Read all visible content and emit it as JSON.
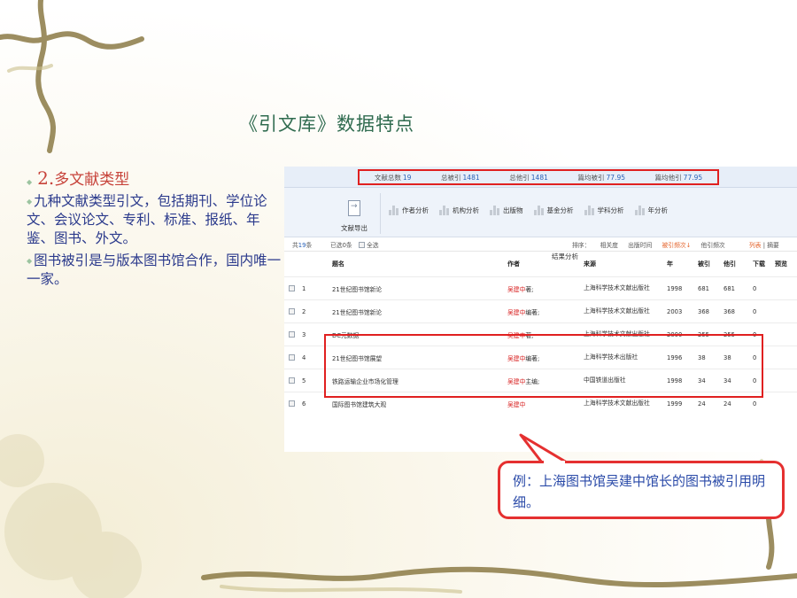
{
  "slide": {
    "title": "《引文库》数据特点",
    "section_number": "2.",
    "section_title": "多文献类型",
    "paragraphs": [
      "九种文献类型引文，包括期刊、学位论文、会议论文、专利、标准、报纸、年鉴、图书、外文。",
      "图书被引是与版本图书馆合作，国内唯一一家。"
    ],
    "callout": "例：上海图书馆吴建中馆长的图书被引用明细。"
  },
  "panel": {
    "stats": [
      {
        "label": "文献总数",
        "value": "19"
      },
      {
        "label": "总被引",
        "value": "1481"
      },
      {
        "label": "总他引",
        "value": "1481"
      },
      {
        "label": "篇均被引",
        "value": "77.95"
      },
      {
        "label": "篇均他引",
        "value": "77.95"
      }
    ],
    "export_label": "文献导出",
    "analysis_tools": [
      "作者分析",
      "机构分析",
      "出版物",
      "基金分析",
      "学科分析",
      "年分析"
    ],
    "result_label": "结果分析",
    "toolbar": {
      "count_prefix": "共",
      "count": "19",
      "count_suffix": "条",
      "selected": "已选0条",
      "select_all": "全选",
      "sort_label": "排序：",
      "sort_options": [
        "相关度",
        "出版时间",
        "被引频次↓",
        "他引频次"
      ],
      "active_sort": "被引频次↓",
      "view_list": "列表",
      "view_sep": "|",
      "view_abstract": "摘要"
    },
    "table": {
      "headers": {
        "title": "题名",
        "author": "作者",
        "source": "来源",
        "year": "年",
        "cited": "被引",
        "other": "他引",
        "download": "下载",
        "preview": "预览"
      },
      "rows": [
        {
          "no": "1",
          "title": "21世纪图书馆新论",
          "author_name": "吴建中",
          "author_role": "著;",
          "source": "上海科学技术文献出版社",
          "year": "1998",
          "cited": "681",
          "other": "681",
          "download": "0"
        },
        {
          "no": "2",
          "title": "21世纪图书馆新论",
          "author_name": "吴建中",
          "author_role": "编著;",
          "source": "上海科学技术文献出版社",
          "year": "2003",
          "cited": "368",
          "other": "368",
          "download": "0"
        },
        {
          "no": "3",
          "title": "DC元数据",
          "author_name": "吴建中",
          "author_role": "著;",
          "source": "上海科学技术文献出版社",
          "year": "2000",
          "cited": "255",
          "other": "255",
          "download": "0"
        },
        {
          "no": "4",
          "title": "21世纪图书馆展望",
          "author_name": "吴建中",
          "author_role": "编著;",
          "source": "上海科学技术出版社",
          "year": "1996",
          "cited": "38",
          "other": "38",
          "download": "0"
        },
        {
          "no": "5",
          "title": "铁路运输企业市场化管理",
          "author_name": "吴建中",
          "author_role": "主编;",
          "source": "中国铁道出版社",
          "year": "1998",
          "cited": "34",
          "other": "34",
          "download": "0"
        },
        {
          "no": "6",
          "title": "国际图书馆建筑大观",
          "author_name": "吴建中",
          "author_role": "",
          "source": "上海科学技术文献出版社",
          "year": "1999",
          "cited": "24",
          "other": "24",
          "download": "0"
        }
      ]
    }
  },
  "colors": {
    "title_green": "#2f6b4f",
    "body_blue": "#2b3a8c",
    "heading_red": "#c7433a",
    "highlight_red": "#e02020",
    "link_blue": "#2a62b8",
    "active_orange": "#e4632b"
  }
}
